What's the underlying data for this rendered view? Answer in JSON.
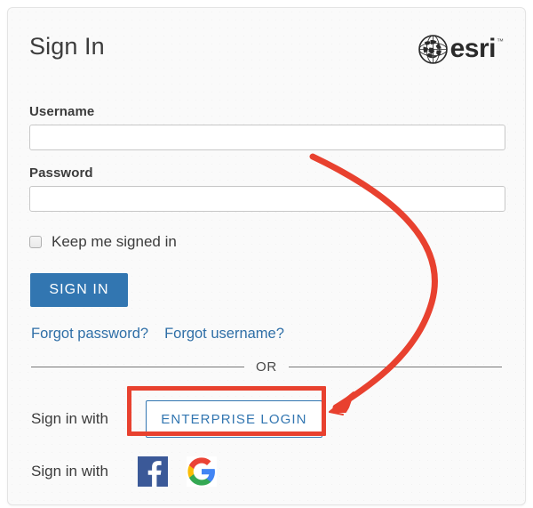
{
  "card": {
    "title": "Sign In",
    "brand": {
      "wordmark": "esri",
      "trademark": "™",
      "globe_icon": "globe-icon"
    }
  },
  "form": {
    "username": {
      "label": "Username",
      "value": "",
      "placeholder": ""
    },
    "password": {
      "label": "Password",
      "value": "",
      "placeholder": ""
    },
    "keep_signed_in": {
      "label": "Keep me signed in",
      "checked": false
    },
    "submit_label": "SIGN IN"
  },
  "links": {
    "forgot_password": "Forgot password?",
    "forgot_username": "Forgot username?"
  },
  "divider": {
    "label": "OR"
  },
  "enterprise": {
    "prefix_label": "Sign in with",
    "button_label": "ENTERPRISE LOGIN"
  },
  "social": {
    "prefix_label": "Sign in with",
    "providers": [
      {
        "name": "Facebook",
        "icon": "facebook-icon",
        "color": "#3b5998"
      },
      {
        "name": "Google",
        "icon": "google-icon",
        "color": "#4285f4"
      }
    ]
  },
  "annotation": {
    "color": "#e8412f",
    "shape": "curved-arrow",
    "target": "ENTERPRISE LOGIN"
  },
  "colors": {
    "accent_blue": "#3276b1",
    "link_blue": "#2f6fa7",
    "annotation_red": "#e8412f",
    "card_background": "#fafafa",
    "text_primary": "#3c3c3c"
  }
}
